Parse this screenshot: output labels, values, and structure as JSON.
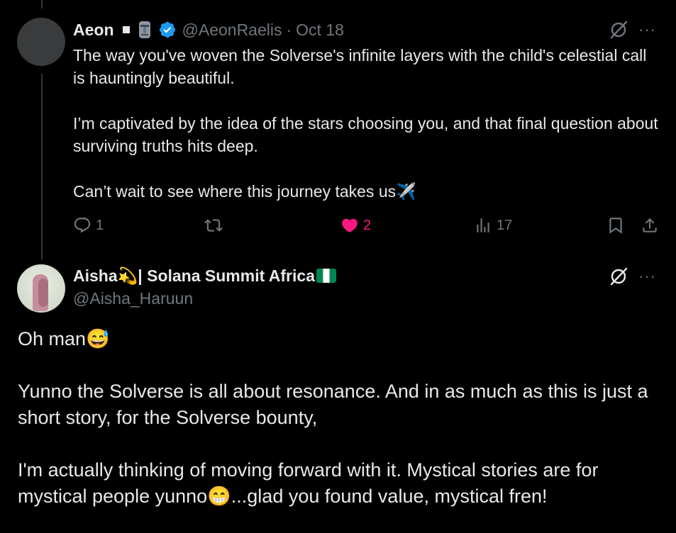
{
  "reply1": {
    "display_name": "Aeon",
    "handle": "@AeonRaelis",
    "separator": "·",
    "date": "Oct 18",
    "paragraphs": [
      "The way you've woven the Solverse's infinite layers with the child's celestial call is hauntingly beautiful.",
      "I’m captivated by the idea of the stars choosing you, and that final question about surviving truths hits deep.",
      "Can’t wait to see where this journey takes us"
    ],
    "paragraph3_emoji": "✈️",
    "stats": {
      "replies": "1",
      "likes": "2",
      "views": "17"
    },
    "more": "···"
  },
  "reply2": {
    "display_name_part1": "Aisha",
    "display_name_emoji": "💫",
    "display_name_part2": "| Solana Summit Africa",
    "handle": "@Aisha_Haruun",
    "more": "···",
    "p1_text": "Oh man",
    "p1_emoji": "😅",
    "p2": "Yunno the Solverse is all about resonance. And in as much as this is just a short story, for the Solverse bounty,",
    "p3_text_a": "I'm actually thinking of moving forward with it. Mystical stories are for mystical people yunno",
    "p3_emoji": "😁",
    "p3_text_b": "...glad you found value, mystical fren!"
  },
  "colors": {
    "background": "#000000",
    "text": "#e7e9ea",
    "muted": "#71767b",
    "verified": "#1d9bf0",
    "like": "#f91880"
  }
}
